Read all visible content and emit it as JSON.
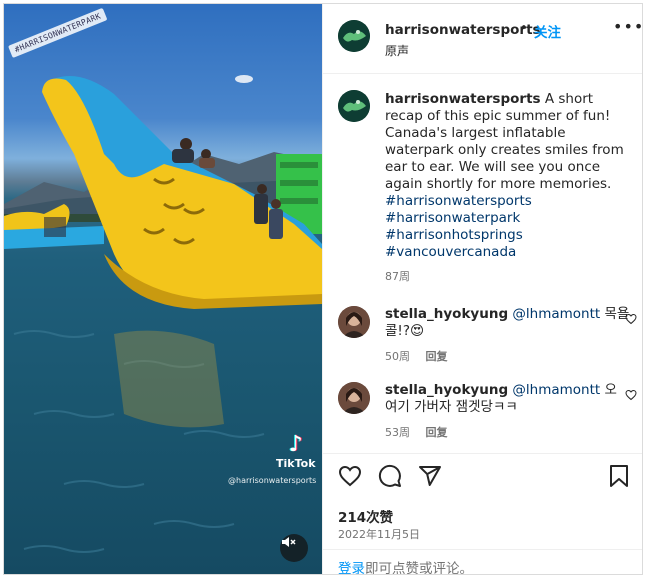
{
  "media": {
    "watermark_tag": "#HARRISONWATERPARK",
    "tiktok_brand": "TikTok",
    "tiktok_user": "@harrisonwatersports",
    "mute_icon": "speaker-muted-icon"
  },
  "header": {
    "username": "harrisonwatersports",
    "separator": "•",
    "follow_label": "关注",
    "audio_label": "原声",
    "more_label": "•••"
  },
  "caption": {
    "username": "harrisonwatersports",
    "text": "A short recap of this epic summer of fun! Canada's largest inflatable waterpark only creates smiles from ear to ear. We will see you once again shortly for more memories.",
    "hashtags": [
      "#harrisonwatersports",
      "#harrisonwaterpark",
      "#harrisonhotsprings",
      "#vancouvercanada"
    ],
    "time": "87周"
  },
  "comments": [
    {
      "username": "stella_hyokyung",
      "mention": "@lhmamontt",
      "text": "목욜콜!?😍",
      "time": "50周",
      "reply": "回复"
    },
    {
      "username": "stella_hyokyung",
      "mention": "@lhmamontt",
      "text": "오 여기 가버자 잼겟당ㅋㅋ",
      "time": "53周",
      "reply": "回复"
    }
  ],
  "footer": {
    "likes": "214次赞",
    "date": "2022年11月5日",
    "login_link": "登录",
    "login_rest": "即可点赞或评论。"
  }
}
